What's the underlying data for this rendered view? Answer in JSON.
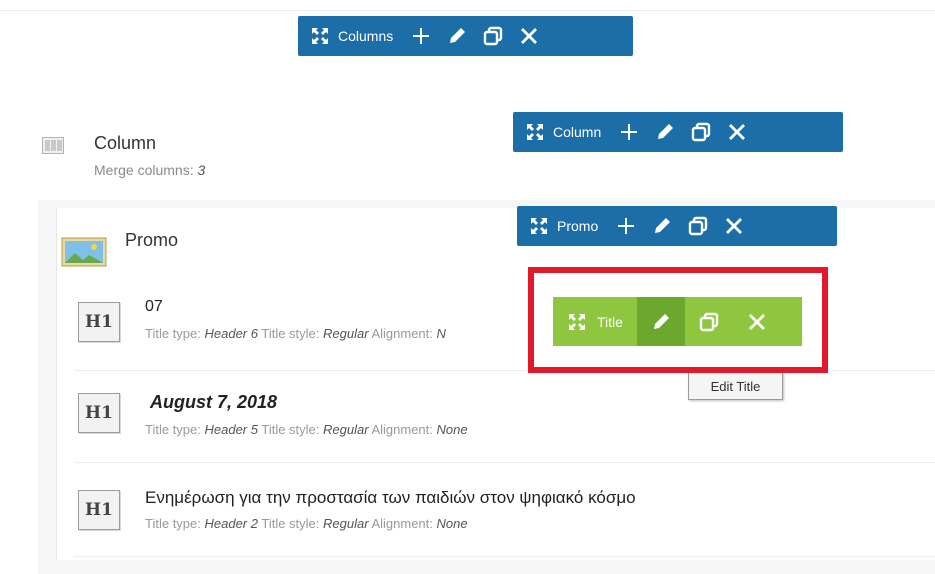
{
  "toolbars": {
    "columns": {
      "label": "Columns"
    },
    "column": {
      "label": "Column"
    },
    "promo": {
      "label": "Promo"
    },
    "title": {
      "label": "Title"
    }
  },
  "tooltip": "Edit Title",
  "column_row": {
    "title": "Column",
    "meta_label": "Merge columns: ",
    "meta_value": "3"
  },
  "promo": {
    "title": "Promo"
  },
  "items": [
    {
      "icon": "H1",
      "title": "07",
      "type_label": "Title type: ",
      "type_value": "Header 6",
      "style_label": "Title style: ",
      "style_value": "Regular",
      "align_label": "Alignment: ",
      "align_value": "N"
    },
    {
      "icon": "H1",
      "title": "August 7, 2018",
      "type_label": "Title type: ",
      "type_value": "Header 5",
      "style_label": "Title style: ",
      "style_value": "Regular",
      "align_label": "Alignment: ",
      "align_value": "None"
    },
    {
      "icon": "H1",
      "title": "Ενημέρωση για την προστασία των παιδιών στον ψηφιακό κόσμο",
      "type_label": "Title type: ",
      "type_value": "Header 2",
      "style_label": "Title style: ",
      "style_value": "Regular",
      "align_label": "Alignment: ",
      "align_value": "None"
    }
  ],
  "colors": {
    "toolbar_blue": "#1b6ea8",
    "toolbar_green": "#8ec63f",
    "highlight_red": "#e2182b"
  }
}
